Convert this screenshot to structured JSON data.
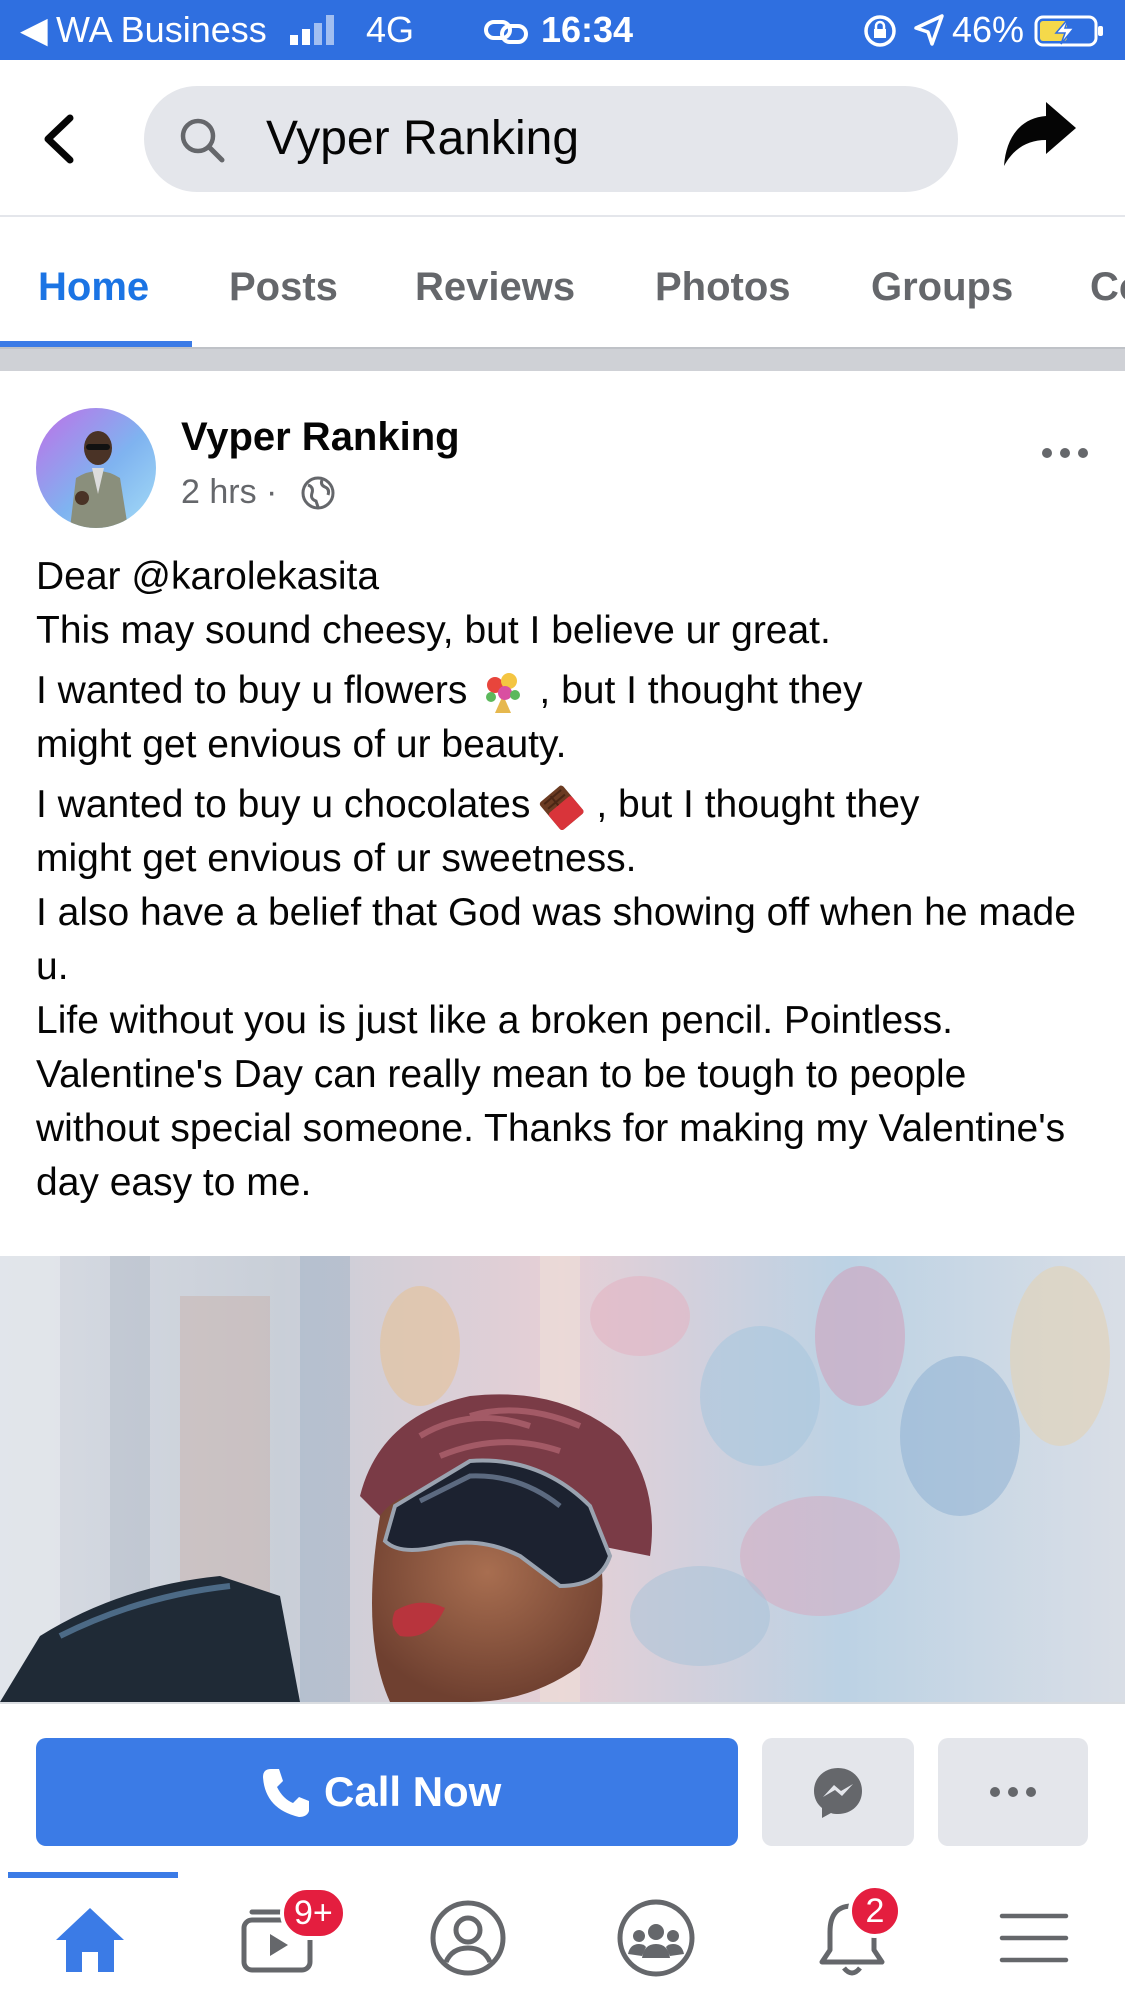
{
  "status_bar": {
    "back_glyph": "◀",
    "carrier": "WA Business",
    "network": "4G",
    "time": "16:34",
    "battery_percent": "46%"
  },
  "search": {
    "query": "Vyper Ranking"
  },
  "tabs": [
    {
      "label": "Home",
      "active": true
    },
    {
      "label": "Posts",
      "active": false
    },
    {
      "label": "Reviews",
      "active": false
    },
    {
      "label": "Photos",
      "active": false
    },
    {
      "label": "Groups",
      "active": false
    },
    {
      "label": "Co",
      "active": false
    }
  ],
  "post": {
    "author": "Vyper Ranking",
    "time": "2 hrs",
    "separator": "·",
    "lines": {
      "l1": "Dear @karolekasita",
      "l2": "This may sound cheesy, but I believe ur great.",
      "l3a": "I wanted to buy u flowers",
      "l3b": ",  but I thought they",
      "l4": "might get envious of ur beauty.",
      "l5a": "I wanted to buy u chocolates",
      "l5b": ", but I thought they",
      "l6": "might get envious of ur sweetness.",
      "l7": "I also have a belief that God was showing off when he made u.",
      "l8": "Life without you is just like a broken pencil. Pointless.",
      "l9": "Valentine's Day can really mean to be tough to people without special someone. Thanks for making my Valentine's day easy to me."
    }
  },
  "actions": {
    "call_label": "Call Now"
  },
  "bottom_nav": {
    "watch_badge": "9+",
    "notifications_badge": "2"
  },
  "colors": {
    "accent": "#3b7be6",
    "status_bar": "#2f6fe0",
    "badge": "#e41e3f",
    "muted": "#65676b"
  },
  "icons": [
    "back-arrow-icon",
    "search-icon",
    "share-icon",
    "globe-icon",
    "more-icon",
    "bouquet-emoji-icon",
    "chocolate-emoji-icon",
    "phone-icon",
    "messenger-icon",
    "home-icon",
    "watch-icon",
    "profile-icon",
    "groups-icon",
    "bell-icon",
    "menu-icon"
  ]
}
